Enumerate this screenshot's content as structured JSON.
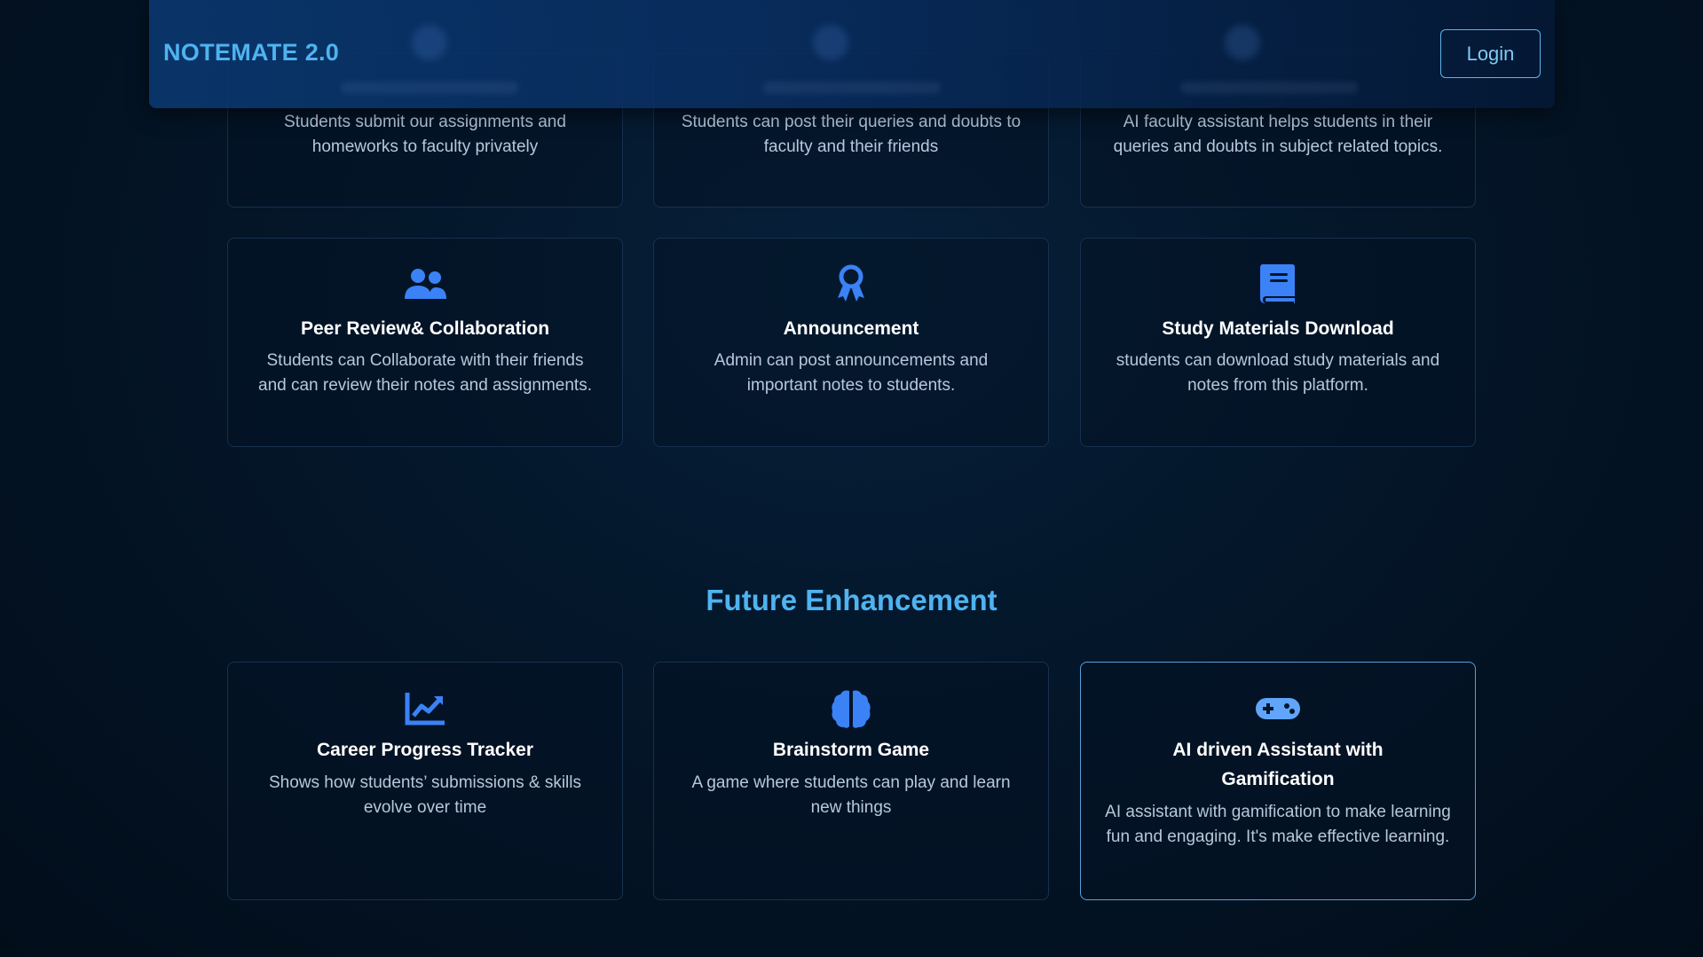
{
  "header": {
    "brand": "NOTEMATE 2.0",
    "login_label": "Login"
  },
  "top_cards": [
    {
      "desc": "Students submit our assignments and homeworks to faculty privately"
    },
    {
      "desc": "Students can post their queries and doubts to faculty and their friends"
    },
    {
      "desc": "AI faculty assistant helps students in their queries and doubts in subject related topics."
    }
  ],
  "features": [
    {
      "icon": "users-icon",
      "title": "Peer Review& Collaboration",
      "desc": "Students can Collaborate with their friends and can review their notes and assignments."
    },
    {
      "icon": "award-icon",
      "title": "Announcement",
      "desc": "Admin can post announcements and important notes to students."
    },
    {
      "icon": "book-icon",
      "title": "Study Materials Download",
      "desc": "students can download study materials and notes from this platform."
    }
  ],
  "future": {
    "title": "Future Enhancement",
    "cards": [
      {
        "icon": "chart-line-icon",
        "title": "Career Progress Tracker",
        "desc": "Shows how students’ submissions & skills evolve over time"
      },
      {
        "icon": "brain-icon",
        "title": "Brainstorm Game",
        "desc": "A game where students can play and learn new things"
      },
      {
        "icon": "gamepad-icon",
        "title": "AI driven Assistant with Gamification",
        "desc": "AI assistant with gamification to make learning fun and engaging. It's make effective learning."
      }
    ]
  },
  "colors": {
    "accent": "#4fb3f0",
    "icon_blue": "#3b82f6",
    "icon_light": "#60a5fa"
  }
}
